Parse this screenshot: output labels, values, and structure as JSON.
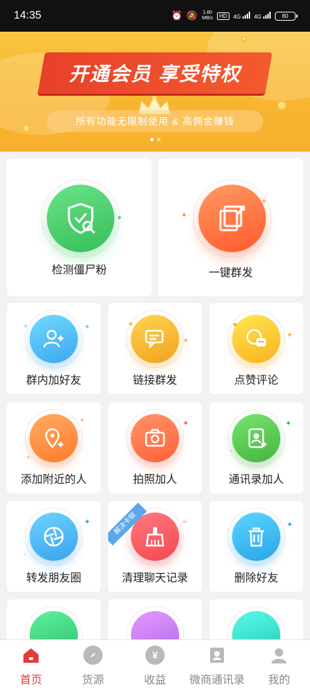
{
  "status_bar": {
    "time": "14:35",
    "speed_top": "1.80",
    "speed_bottom": "MB/s",
    "hd": "HD",
    "net1": "4G",
    "net2": "4G",
    "battery": "80"
  },
  "banner": {
    "title": "开通会员 享受特权",
    "subtitle": "所有功能无限制使用 & 高佣金赚钱"
  },
  "features_top": [
    {
      "label": "检测僵尸粉",
      "icon": "shield-search-icon",
      "color": "#4ccf6a"
    },
    {
      "label": "一键群发",
      "icon": "share-cards-icon",
      "color": "#ff6d3a"
    }
  ],
  "features": [
    {
      "label": "群内加好友",
      "icon": "add-friend-icon",
      "color": "#3da8f0"
    },
    {
      "label": "链接群发",
      "icon": "chat-bubbles-icon",
      "color": "#f0a21e"
    },
    {
      "label": "点赞评论",
      "icon": "comment-bubbles-icon",
      "color": "#f7b31f"
    },
    {
      "label": "添加附近的人",
      "icon": "location-pin-icon",
      "color": "#ff7a2e"
    },
    {
      "label": "拍照加人",
      "icon": "camera-icon",
      "color": "#ff6238"
    },
    {
      "label": "通讯录加人",
      "icon": "contacts-book-icon",
      "color": "#46b33f"
    },
    {
      "label": "转发朋友圈",
      "icon": "aperture-icon",
      "color": "#3aa2ec"
    },
    {
      "label": "清理聊天记录",
      "icon": "broom-icon",
      "color": "#f5474f",
      "tag": "解决卡顿"
    },
    {
      "label": "删除好友",
      "icon": "trash-icon",
      "color": "#2aa4e8"
    }
  ],
  "partial_row": [
    {
      "icon": "user-search-icon",
      "color": "#2ebf6d"
    },
    {
      "icon": "message-icon",
      "color": "#b168e8"
    },
    {
      "icon": "cleaner-icon",
      "color": "#26c8b8"
    }
  ],
  "tabs": [
    {
      "label": "首页",
      "icon": "home-icon",
      "active": true
    },
    {
      "label": "货源",
      "icon": "compass-icon",
      "active": false
    },
    {
      "label": "收益",
      "icon": "yuan-icon",
      "active": false
    },
    {
      "label": "微商通讯录",
      "icon": "contact-card-icon",
      "active": false
    },
    {
      "label": "我的",
      "icon": "profile-icon",
      "active": false
    }
  ]
}
